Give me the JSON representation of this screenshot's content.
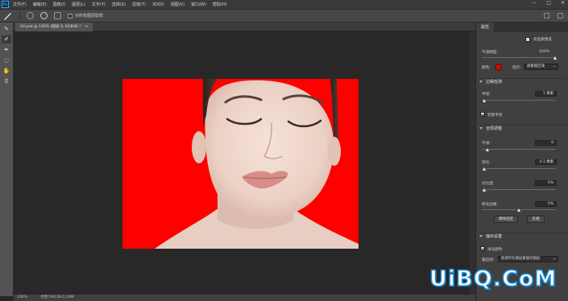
{
  "menubar": {
    "logo": "Ps",
    "items": [
      "文件(F)",
      "编辑(E)",
      "图像(I)",
      "图层(L)",
      "文字(Y)",
      "选择(S)",
      "滤镜(T)",
      "3D(D)",
      "视图(V)",
      "窗口(W)",
      "帮助(H)"
    ],
    "controls": [
      "—",
      "□",
      "✕"
    ]
  },
  "options": {
    "checkbox_label": "对所有图层取样"
  },
  "document": {
    "tab_title": "43.psd @ 100% (图层 0, RGB/8) *",
    "tab_close": "×"
  },
  "status": {
    "zoom": "100%",
    "doc": "文档:594.2K/1.29M"
  },
  "panel": {
    "tab": "属性",
    "show_edges_label": "高品质预览",
    "opacity_label": "不透明度:",
    "opacity_value": "100%",
    "color_label": "颜色:",
    "color_value": "#e00000",
    "indicates_label": "指示:",
    "indicates_value": "被蒙版区域",
    "edge_detect": {
      "title": "边缘检测",
      "radius_label": "半径:",
      "radius_value": "1 像素",
      "smart_radius_label": "智能半径"
    },
    "global": {
      "title": "全局调整",
      "smooth_label": "平滑:",
      "smooth_value": "0",
      "feather_label": "羽化:",
      "feather_value": "0.1 像素",
      "contrast_label": "对比度:",
      "contrast_value": "0%",
      "shift_label": "移动边缘:",
      "shift_value": "0%",
      "clear_btn": "清除选区",
      "invert_btn": "反相"
    },
    "output": {
      "title": "输出设置",
      "decontam_label": "净化颜色",
      "output_label": "输出到:",
      "output_value": "新建带有图层蒙版的图层"
    }
  },
  "watermark": "UiBQ.CoM"
}
